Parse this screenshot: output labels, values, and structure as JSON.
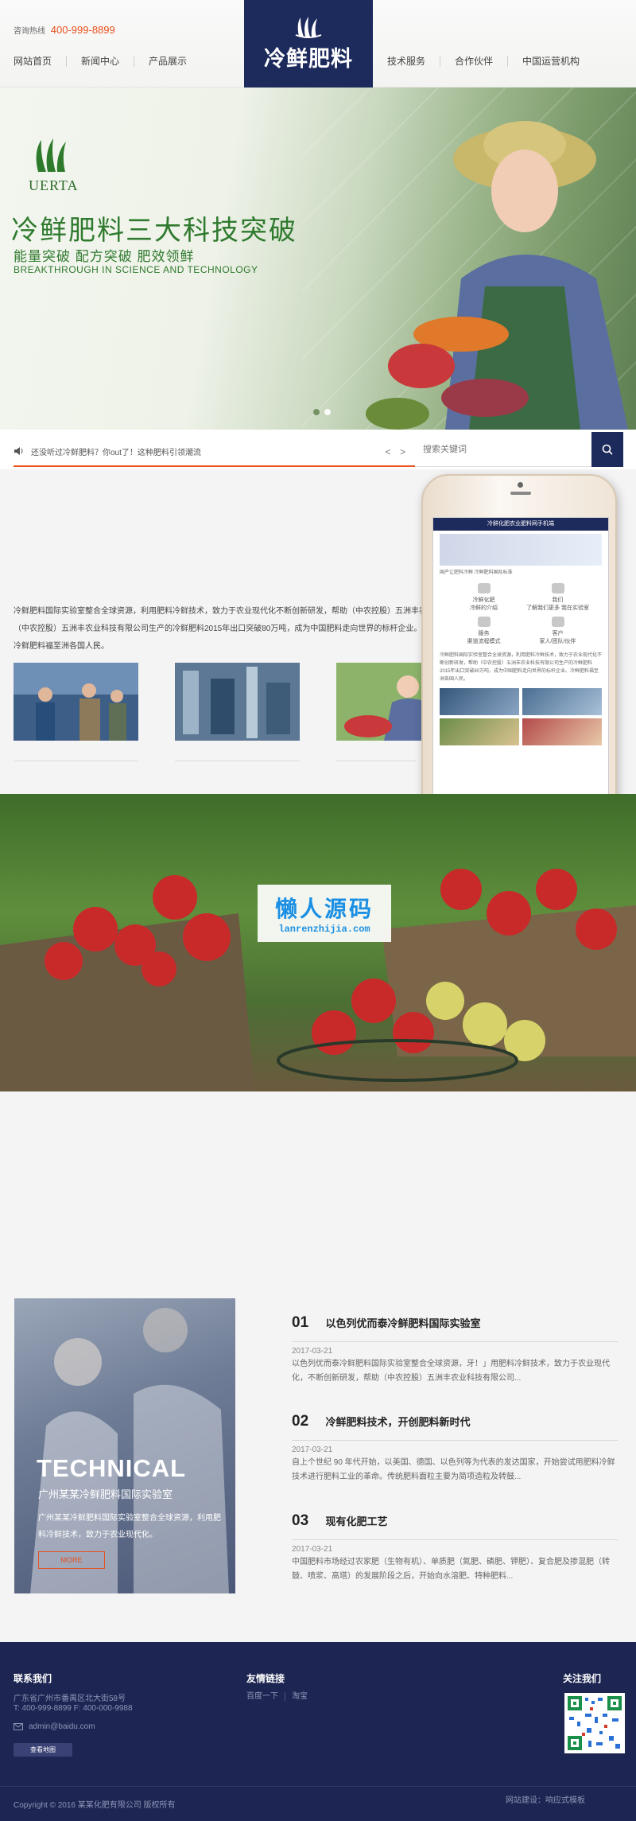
{
  "header": {
    "hotline_label": "咨询热线",
    "hotline_number": "400-999-8899",
    "logo_text": "冷鲜肥料",
    "nav_left": [
      "网站首页",
      "新闻中心",
      "产品展示"
    ],
    "nav_right": [
      "技术服务",
      "合作伙伴",
      "中国运营机构"
    ]
  },
  "banner": {
    "brand_name": "UERTA",
    "title": "冷鲜肥料三大科技突破",
    "subtitle": "能量突破   配方突破   肥效领鲜",
    "subtitle_en": "BREAKTHROUGH IN SCIENCE AND TECHNOLOGY",
    "slide_count": 2,
    "active_slide": 1
  },
  "ticker": {
    "text": "还没听过冷鲜肥料？你out了！这种肥料引领潮流",
    "arrows": "< >"
  },
  "search": {
    "placeholder": "搜索关键词"
  },
  "about": {
    "text": "冷鲜肥料国际实验室整合全球资源，利用肥料冷鲜技术，致力于农业现代化不断创新研发，帮助（中农控股）五洲丰农（中农控股）五洲丰农业科技有限公司生产的冷鲜肥料2015年出口突破80万吨，成为中国肥料走向世界的标杆企业。冷鲜肥料福至洲各国人民。"
  },
  "phone": {
    "header": "冷鲜化肥农业肥料网手机端",
    "tagline": "国产让肥料冷鲜 冷鲜肥料国际标准",
    "grid": [
      {
        "title": "冷鲜化肥",
        "sub": "冷鲜的介绍"
      },
      {
        "title": "我们",
        "sub": "了解我们更多 我在实验室"
      },
      {
        "title": "服务",
        "sub": "渠道流程模式"
      },
      {
        "title": "客户",
        "sub": "家人/团队/伙伴"
      }
    ],
    "text": "冷鲜肥料国际实验室整合全球资源，利用肥料冷鲜技术，致力于农业现代化不断创新研发，帮助（中农控股）五洲丰农业科技有限公司生产的冷鲜肥料2015年出口突破80万吨，成为中国肥料走向世界的标杆企业。冷鲜肥料福至洲各国人民。"
  },
  "watermark": {
    "cn": "懒人源码",
    "en": "lanrenzhijia.com"
  },
  "tech_card": {
    "title": "TECHNICAL",
    "subtitle": "广州某某冷鲜肥料国际实验室",
    "text": "广州某某冷鲜肥料国际实验室整合全球资源，利用肥料冷鲜技术，致力于农业现代化。",
    "more": "MORE"
  },
  "news": [
    {
      "num": "01",
      "title": "以色列优而泰冷鲜肥料国际实验室",
      "date": "2017-03-21",
      "desc": "以色列优而泰冷鲜肥料国际实验室整合全球资源，牙！」用肥料冷鲜技术，致力于农业现代化，不断创新研发，帮助（中农控股）五洲丰农业科技有限公司..."
    },
    {
      "num": "02",
      "title": "冷鲜肥料技术，开创肥料新时代",
      "date": "2017-03-21",
      "desc": "自上个世纪 90 年代开始，以美国、德国、以色列等为代表的发达国家，开始尝试用肥料冷鲜技术进行肥料工业的革命。传统肥料面粒主要为简项造粒及转鼓..."
    },
    {
      "num": "03",
      "title": "现有化肥工艺",
      "date": "2017-03-21",
      "desc": "中国肥料市场经过农家肥（生物有机）、单质肥（氮肥、磷肥、钾肥）、复合肥及掺混肥（转鼓、喷浆、高塔）的发展阶段之后，开始向水溶肥、特种肥料..."
    }
  ],
  "footer": {
    "contact_title": "联系我们",
    "address": "广东省广州市番禺区北大街58号",
    "phone": "T: 400-999-8899 F: 400-000-9988",
    "email": "admin@baidu.com",
    "map_button": "查看地图",
    "links_title": "友情链接",
    "links": [
      "百度一下",
      "淘宝"
    ],
    "follow_title": "关注我们",
    "copyright": "Copyright © 2016 某某化肥有限公司 版权所有",
    "built_by": "网站建设：响应式模板"
  },
  "colors": {
    "navy": "#1d2a5c",
    "accent_orange": "#e8501c",
    "green": "#2f7a2e",
    "footer_bg": "#1d2552"
  }
}
